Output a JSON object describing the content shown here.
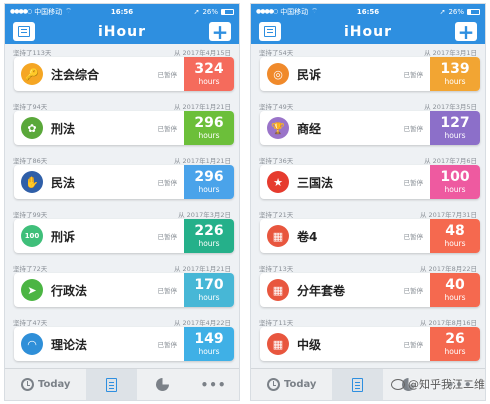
{
  "app_title": "iHour",
  "status_left": {
    "signal": "●●●●○",
    "carrier": "中国移动",
    "wifi": "⌔",
    "time": "16:56",
    "battery": "26%"
  },
  "status_right": {
    "signal": "●●●●○",
    "carrier": "中国移动",
    "wifi": "⌔",
    "time": "16:56",
    "battery": "26%"
  },
  "paused_label": "已暂停",
  "hours_unit": "hours",
  "tabs": {
    "today": "Today"
  },
  "watermark": "@知乎我江二维",
  "left_items": [
    {
      "days": "坚持了113天",
      "since": "从 2017年4月15日",
      "name": "注会综合",
      "hours": "324",
      "color": "#f56b5c",
      "icon": "key-icon",
      "glyph": "🔑",
      "icon_bg": "#f5a623"
    },
    {
      "days": "坚持了94天",
      "since": "从 2017年1月21日",
      "name": "刑法",
      "hours": "296",
      "color": "#6cbf3a",
      "icon": "plant-icon",
      "glyph": "✿",
      "icon_bg": "#5aa83a"
    },
    {
      "days": "坚持了86天",
      "since": "从 2017年1月21日",
      "name": "民法",
      "hours": "296",
      "color": "#4aa3ea",
      "icon": "handshake-icon",
      "glyph": "✋",
      "icon_bg": "#2f5fa8"
    },
    {
      "days": "坚持了99天",
      "since": "从 2017年3月2日",
      "name": "刑诉",
      "hours": "226",
      "color": "#25b08a",
      "icon": "score-100-icon",
      "glyph": "100",
      "icon_bg": "#3fbf7a"
    },
    {
      "days": "坚持了72天",
      "since": "从 2017年1月21日",
      "name": "行政法",
      "hours": "170",
      "color": "#47b7d6",
      "icon": "compass-icon",
      "glyph": "➤",
      "icon_bg": "#4bb543"
    },
    {
      "days": "坚持了47天",
      "since": "从 2017年4月22日",
      "name": "理论法",
      "hours": "149",
      "color": "#3fb0e6",
      "icon": "wifi-icon",
      "glyph": "◠",
      "icon_bg": "#2f8fd8"
    }
  ],
  "right_items": [
    {
      "days": "坚持了54天",
      "since": "从 2017年3月1日",
      "name": "民诉",
      "hours": "139",
      "color": "#f2a533",
      "icon": "target-icon",
      "glyph": "◎",
      "icon_bg": "#f08a2b"
    },
    {
      "days": "坚持了49天",
      "since": "从 2017年3月5日",
      "name": "商经",
      "hours": "127",
      "color": "#8c6fc9",
      "icon": "trophy-icon",
      "glyph": "🏆",
      "icon_bg": "#9a74c9"
    },
    {
      "days": "坚持了36天",
      "since": "从 2017年7月6日",
      "name": "三国法",
      "hours": "100",
      "color": "#ee5aa0",
      "icon": "china-flag-icon",
      "glyph": "★",
      "icon_bg": "#e63b2e"
    },
    {
      "days": "坚持了21天",
      "since": "从 2017年7月31日",
      "name": "卷4",
      "hours": "48",
      "color": "#f5694f",
      "icon": "clapperboard-icon",
      "glyph": "▦",
      "icon_bg": "#e8563e"
    },
    {
      "days": "坚持了13天",
      "since": "从 2017年8月22日",
      "name": "分年套卷",
      "hours": "40",
      "color": "#f5694f",
      "icon": "clapperboard-icon",
      "glyph": "▦",
      "icon_bg": "#e8563e"
    },
    {
      "days": "坚持了11天",
      "since": "从 2017年8月16日",
      "name": "中级",
      "hours": "26",
      "color": "#f5694f",
      "icon": "clapperboard-icon",
      "glyph": "▦",
      "icon_bg": "#e8563e"
    }
  ]
}
